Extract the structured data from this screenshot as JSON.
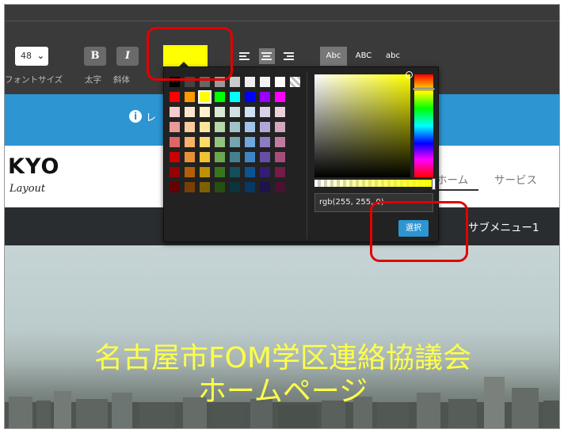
{
  "toolbar": {
    "font_size_value": "48",
    "bold_label": "B",
    "italic_label": "I",
    "case_buttons": [
      "Abc",
      "ABC",
      "abc"
    ],
    "labels": {
      "font_size": "フォントサイズ",
      "bold": "太字",
      "italic": "斜体"
    },
    "text_color_value": "#ffff00"
  },
  "notice": {
    "text": "レ"
  },
  "site": {
    "logo_main": "KYO",
    "logo_sub": "Layout",
    "nav": {
      "home": "ホーム",
      "service": "サービス"
    },
    "submenu": "サブメニュー1"
  },
  "hero": {
    "title_line1": "名古屋市FOM学区連絡協議会",
    "title_line2": "ホームページ",
    "title_color": "#ffff4a"
  },
  "color_picker": {
    "rgb_value": "rgb(255, 255, 0)",
    "choose_button": "選択",
    "selected_color": "#ffff00",
    "palette": [
      [
        "#000000",
        "#434343",
        "#666666",
        "#999999",
        "#cccccc",
        "#efefef",
        "#f3f3f3",
        "#ffffff",
        "transparent"
      ],
      [
        "#ff0000",
        "#ff9900",
        "#ffff00",
        "#00ff00",
        "#00ffff",
        "#0000ff",
        "#9900ff",
        "#ff00ff"
      ],
      [
        "#f4cccc",
        "#fce5cd",
        "#fff2cc",
        "#d9ead3",
        "#d0e0e3",
        "#cfe2f3",
        "#d9d2e9",
        "#ead1dc"
      ],
      [
        "#ea9999",
        "#f9cb9c",
        "#ffe599",
        "#b6d7a8",
        "#a2c4c9",
        "#9fc5e8",
        "#b4a7d6",
        "#d5a6bd"
      ],
      [
        "#e06666",
        "#f6b26b",
        "#ffd966",
        "#93c47d",
        "#76a5af",
        "#6fa8dc",
        "#8e7cc3",
        "#c27ba0"
      ],
      [
        "#cc0000",
        "#e69138",
        "#f1c232",
        "#6aa84f",
        "#45818e",
        "#3d85c6",
        "#674ea7",
        "#a64d79"
      ],
      [
        "#990000",
        "#b45f06",
        "#bf9000",
        "#38761d",
        "#134f5c",
        "#0b5394",
        "#351c75",
        "#741b47"
      ],
      [
        "#660000",
        "#783f04",
        "#7f6000",
        "#274e13",
        "#0c343d",
        "#073763",
        "#20124d",
        "#4c1130"
      ]
    ]
  },
  "annotation_color": "#e30000"
}
